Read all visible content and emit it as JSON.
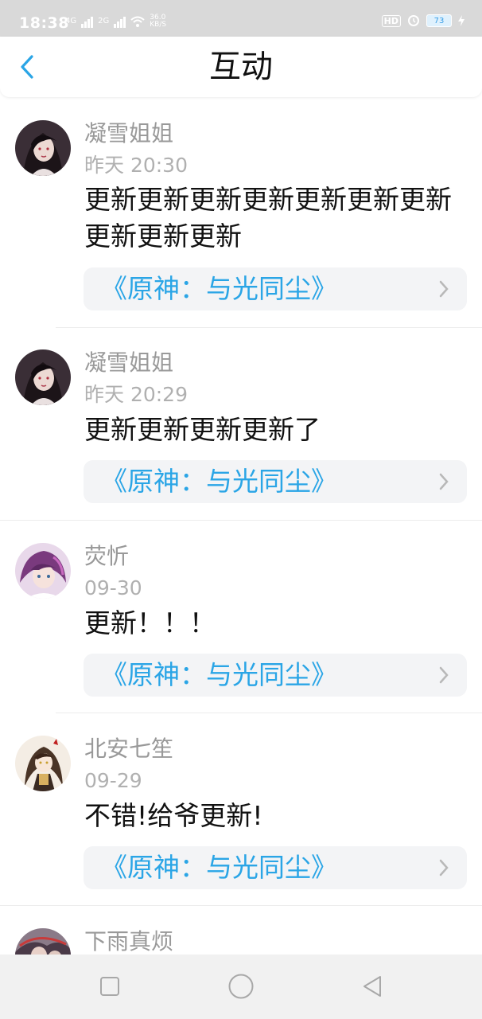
{
  "status_bar": {
    "time": "18:38",
    "network_1": "4G",
    "network_2": "2G",
    "speed_value": "36.0",
    "speed_unit": "KB/S",
    "hd_label": "HD",
    "battery": "73"
  },
  "header": {
    "title": "互动"
  },
  "colors": {
    "accent": "#2aa5e6",
    "name": "#999999",
    "card_bg": "#f3f4f6"
  },
  "feed": [
    {
      "user": "凝雪姐姐",
      "time": "昨天 20:30",
      "content": "更新更新更新更新更新更新更新更新更新更新",
      "book": "《原神：与光同尘》"
    },
    {
      "user": "凝雪姐姐",
      "time": "昨天 20:29",
      "content": "更新更新更新更新了",
      "book": "《原神：与光同尘》"
    },
    {
      "user": "荧忻",
      "time": "09-30",
      "content": "更新！！！",
      "book": "《原神：与光同尘》"
    },
    {
      "user": "北安七笙",
      "time": "09-29",
      "content": "不错!给爷更新!",
      "book": "《原神：与光同尘》"
    },
    {
      "user": "下雨真烦"
    }
  ]
}
